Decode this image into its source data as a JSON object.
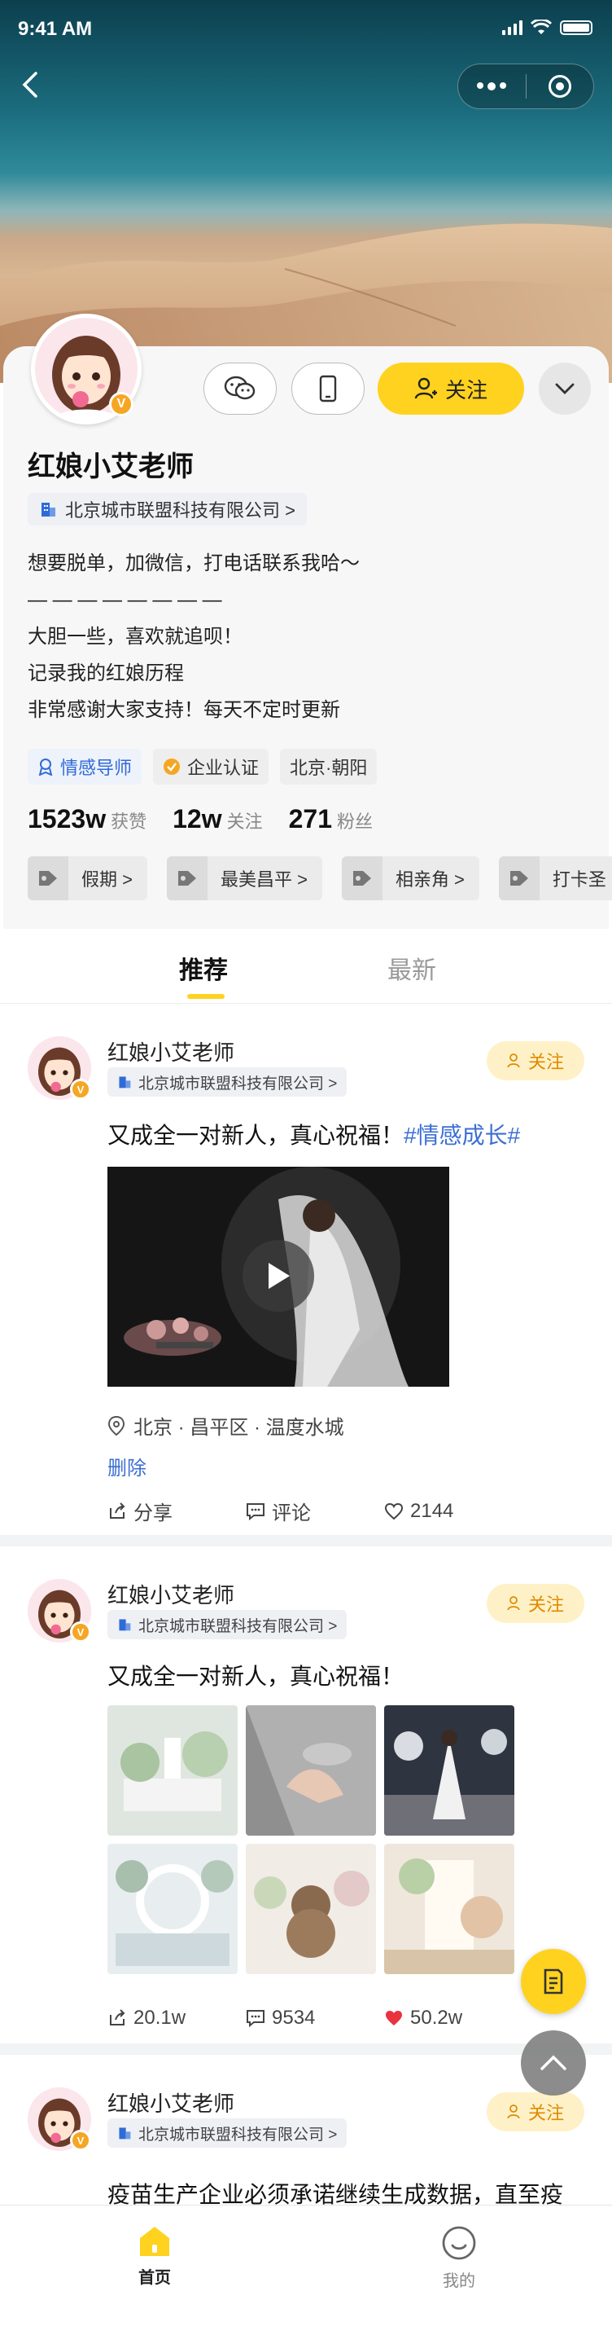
{
  "status_bar": {
    "time": "9:41 AM"
  },
  "profile": {
    "name": "红娘小艾老师",
    "company": "北京城市联盟科技有限公司 >",
    "follow_label": "关注",
    "bio": [
      "想要脱单，加微信，打电话联系我哈～",
      "— — — — — — — —",
      "大胆一些，喜欢就追呗！",
      "记录我的红娘历程",
      "非常感谢大家支持！每天不定时更新"
    ],
    "tags": {
      "mentor": "情感导师",
      "verified": "企业认证",
      "location": "北京·朝阳"
    },
    "stats": [
      {
        "value": "1523w",
        "label": "获赞"
      },
      {
        "value": "12w",
        "label": "关注"
      },
      {
        "value": "271",
        "label": "粉丝"
      }
    ],
    "topics": [
      "假期 >",
      "最美昌平 >",
      "相亲角 >",
      "打卡圣"
    ]
  },
  "tabs": {
    "recommend": "推荐",
    "latest": "最新"
  },
  "posts": [
    {
      "author": "红娘小艾老师",
      "company": "北京城市联盟科技有限公司 >",
      "follow": "关注",
      "text": "又成全一对新人，真心祝福！",
      "hashtag": "#情感成长#",
      "location": "北京 · 昌平区 · 温度水城",
      "delete": "删除",
      "share": "分享",
      "comment": "评论",
      "likes": "2144"
    },
    {
      "author": "红娘小艾老师",
      "company": "北京城市联盟科技有限公司 >",
      "follow": "关注",
      "text": "又成全一对新人，真心祝福！",
      "share": "20.1w",
      "comment": "9534",
      "likes": "50.2w"
    },
    {
      "author": "红娘小艾老师",
      "company": "北京城市联盟科技有限公司 >",
      "follow": "关注",
      "text": "疫苗生产企业必须承诺继续生成数据，直至疫"
    }
  ],
  "bottom_nav": {
    "home": "首页",
    "mine": "我的"
  },
  "colors": {
    "accent": "#ffd21f",
    "link": "#3d6fd4",
    "like": "#e8343f",
    "follow_text": "#e08a00"
  }
}
